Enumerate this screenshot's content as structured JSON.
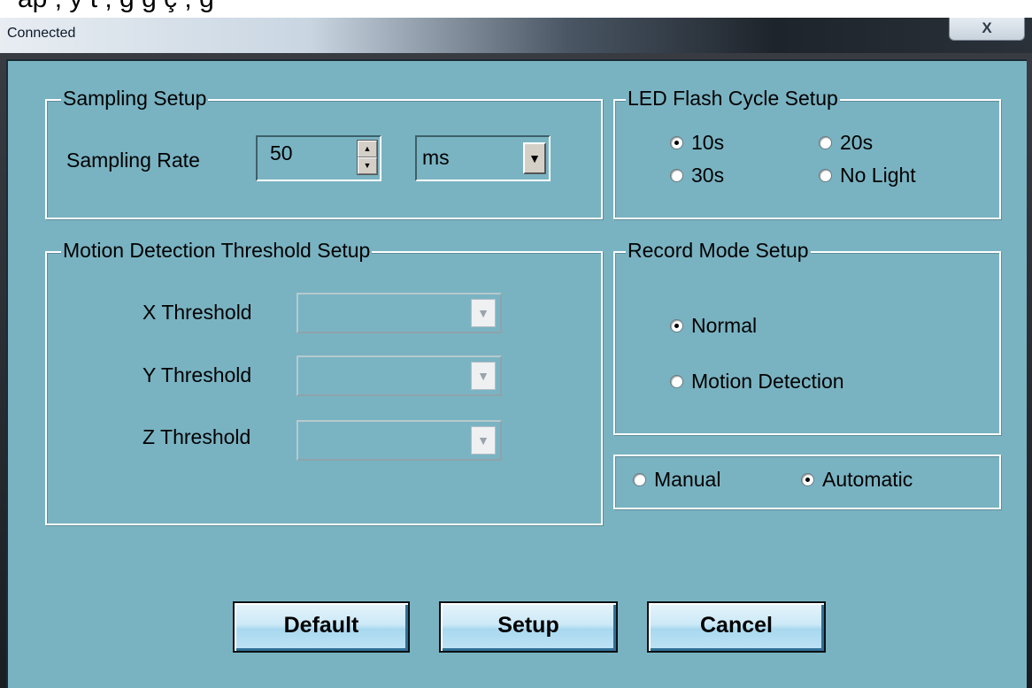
{
  "window": {
    "title": "Connected",
    "close_label": "X"
  },
  "background_text": "ap ,  y  t      ,      g  g  ç ,      g  ",
  "sampling": {
    "group_label": "Sampling Setup",
    "rate_label": "Sampling Rate",
    "rate_value": "50",
    "unit_value": "ms"
  },
  "led": {
    "group_label": "LED Flash Cycle Setup",
    "options": [
      {
        "label": "10s",
        "selected": true
      },
      {
        "label": "20s",
        "selected": false
      },
      {
        "label": "30s",
        "selected": false
      },
      {
        "label": "No Light",
        "selected": false
      }
    ]
  },
  "motion": {
    "group_label": "Motion Detection Threshold Setup",
    "x_label": "X Threshold",
    "y_label": "Y Threshold",
    "z_label": "Z Threshold"
  },
  "record": {
    "group_label": "Record Mode Setup",
    "options": [
      {
        "label": "Normal",
        "selected": true
      },
      {
        "label": "Motion Detection",
        "selected": false
      }
    ]
  },
  "mode": {
    "options": [
      {
        "label": "Manual",
        "selected": false
      },
      {
        "label": "Automatic",
        "selected": true
      }
    ]
  },
  "buttons": {
    "default": "Default",
    "setup": "Setup",
    "cancel": "Cancel"
  },
  "icons": {
    "spin_up": "spin-up-icon",
    "spin_down": "spin-down-icon",
    "dropdown": "chevron-down-icon"
  },
  "colors": {
    "client_bg": "#79b3c2",
    "button_face": "#bfe3f5"
  }
}
